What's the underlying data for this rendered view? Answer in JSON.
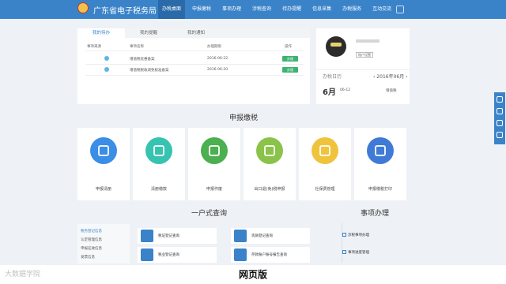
{
  "header": {
    "site_title": "广东省电子税务局",
    "nav": [
      "办税桌面",
      "申报缴税",
      "事项办理",
      "涉税查询",
      "待办提醒",
      "信息采集",
      "办税服务",
      "互动交流"
    ]
  },
  "todo": {
    "tabs": [
      "我的待办",
      "我的提醒",
      "我的通知"
    ],
    "columns": [
      "事项来源",
      "事项名称",
      "办理期限",
      "操作"
    ],
    "rows": [
      {
        "name": "增值税优惠备案",
        "deadline": "2016-06-22",
        "action": "办理"
      },
      {
        "name": "增值税税收减免核准备案",
        "deadline": "2016-06-20",
        "action": "办理"
      }
    ]
  },
  "profile": {
    "account_button": "账户设置",
    "calendar_label": "办税日历",
    "calendar_month": "‹ 2016年06月 ›",
    "big_month": "6月",
    "entry_date": "06-12",
    "entry_kind": "增值税"
  },
  "sections": {
    "declare": "申报缴税",
    "query": "一户式查询",
    "matters": "事项办理"
  },
  "tiles": [
    {
      "label": "申报清册",
      "color": "#3a8ee6"
    },
    {
      "label": "清册缴款",
      "color": "#36c3b0"
    },
    {
      "label": "申报作废",
      "color": "#4caf50"
    },
    {
      "label": "出口退(免)税申报",
      "color": "#8bc34a"
    },
    {
      "label": "社保费管理",
      "color": "#f0c33c"
    },
    {
      "label": "申报缴税打印",
      "color": "#3f7bd6"
    }
  ],
  "query": {
    "sidebar": [
      "税务登记信息",
      "认定管理信息",
      "申报征收信息",
      "发票信息"
    ],
    "items": [
      "税证登记查询",
      "资质登记查询",
      "税业登记查询",
      "存款账户账号报告查询"
    ]
  },
  "matters": [
    "涉税事项办理",
    "事项进度管理"
  ],
  "caption": "网页版",
  "watermark": "大数据学院"
}
